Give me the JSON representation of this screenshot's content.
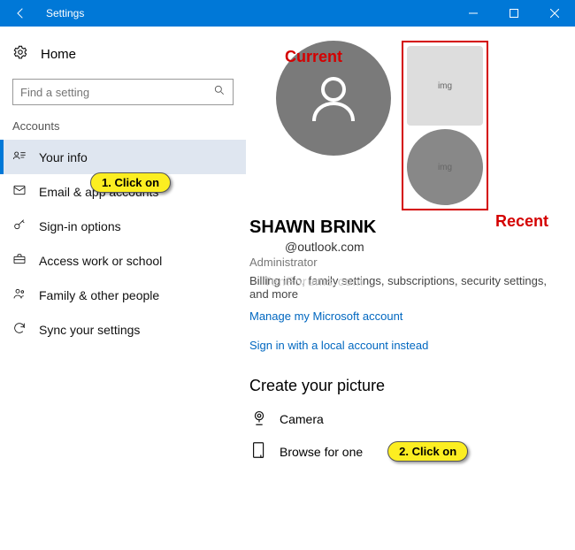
{
  "titlebar": {
    "title": "Settings"
  },
  "sidebar": {
    "home": "Home",
    "search_placeholder": "Find a setting",
    "section": "Accounts",
    "items": [
      {
        "label": "Your info"
      },
      {
        "label": "Email & app accounts"
      },
      {
        "label": "Sign-in options"
      },
      {
        "label": "Access work or school"
      },
      {
        "label": "Family & other people"
      },
      {
        "label": "Sync your settings"
      }
    ]
  },
  "annotations": {
    "current": "Current",
    "recent": "Recent",
    "callout1": "1. Click on",
    "callout2": "2. Click on"
  },
  "profile": {
    "name": "SHAWN BRINK",
    "email": "@outlook.com",
    "role": "Administrator",
    "desc": "Billing info, family settings, subscriptions, security settings, and more",
    "manage_link": "Manage my Microsoft account",
    "local_link": "Sign in with a local account instead"
  },
  "picture": {
    "heading": "Create your picture",
    "camera": "Camera",
    "browse": "Browse for one"
  },
  "watermark": "TenForums.com"
}
